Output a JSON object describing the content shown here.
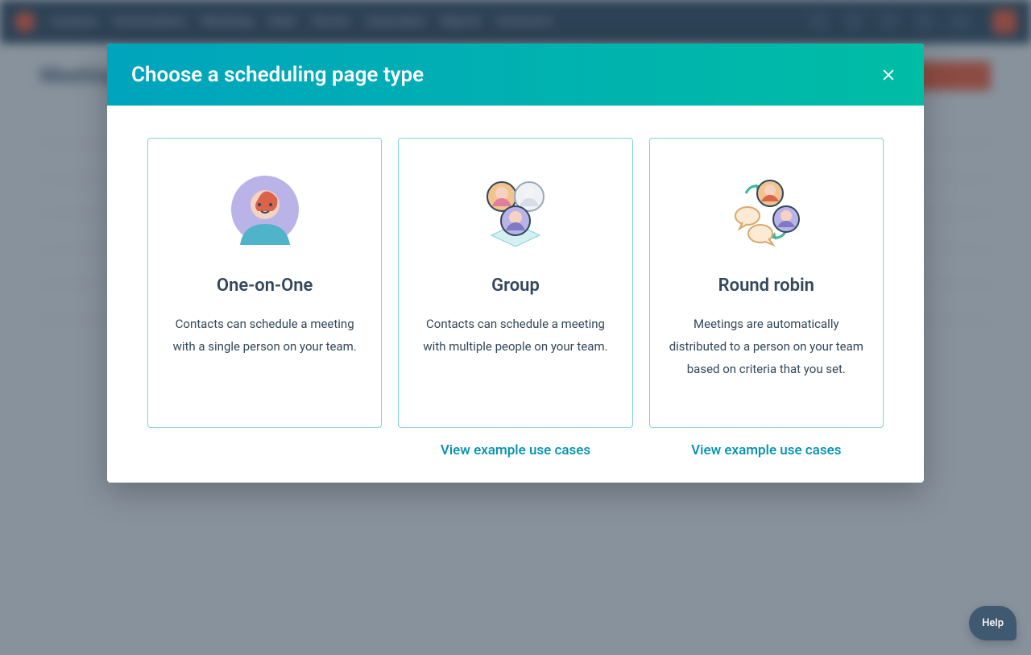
{
  "nav": {
    "items": [
      "Contacts",
      "Conversations",
      "Marketing",
      "Sales",
      "Service",
      "Automation",
      "Reports",
      "Commerce"
    ]
  },
  "page": {
    "title": "Meetings",
    "action_label": "Create"
  },
  "modal": {
    "title": "Choose a scheduling page type",
    "options": [
      {
        "title": "One-on-One",
        "desc": "Contacts can schedule a meeting with a single person on your team."
      },
      {
        "title": "Group",
        "desc": "Contacts can schedule a meeting with multiple people on your team.",
        "link": "View example use cases"
      },
      {
        "title": "Round robin",
        "desc": "Meetings are automatically distributed to a person on your team based on criteria that you set.",
        "link": "View example use cases"
      }
    ]
  },
  "help": {
    "label": "Help"
  }
}
